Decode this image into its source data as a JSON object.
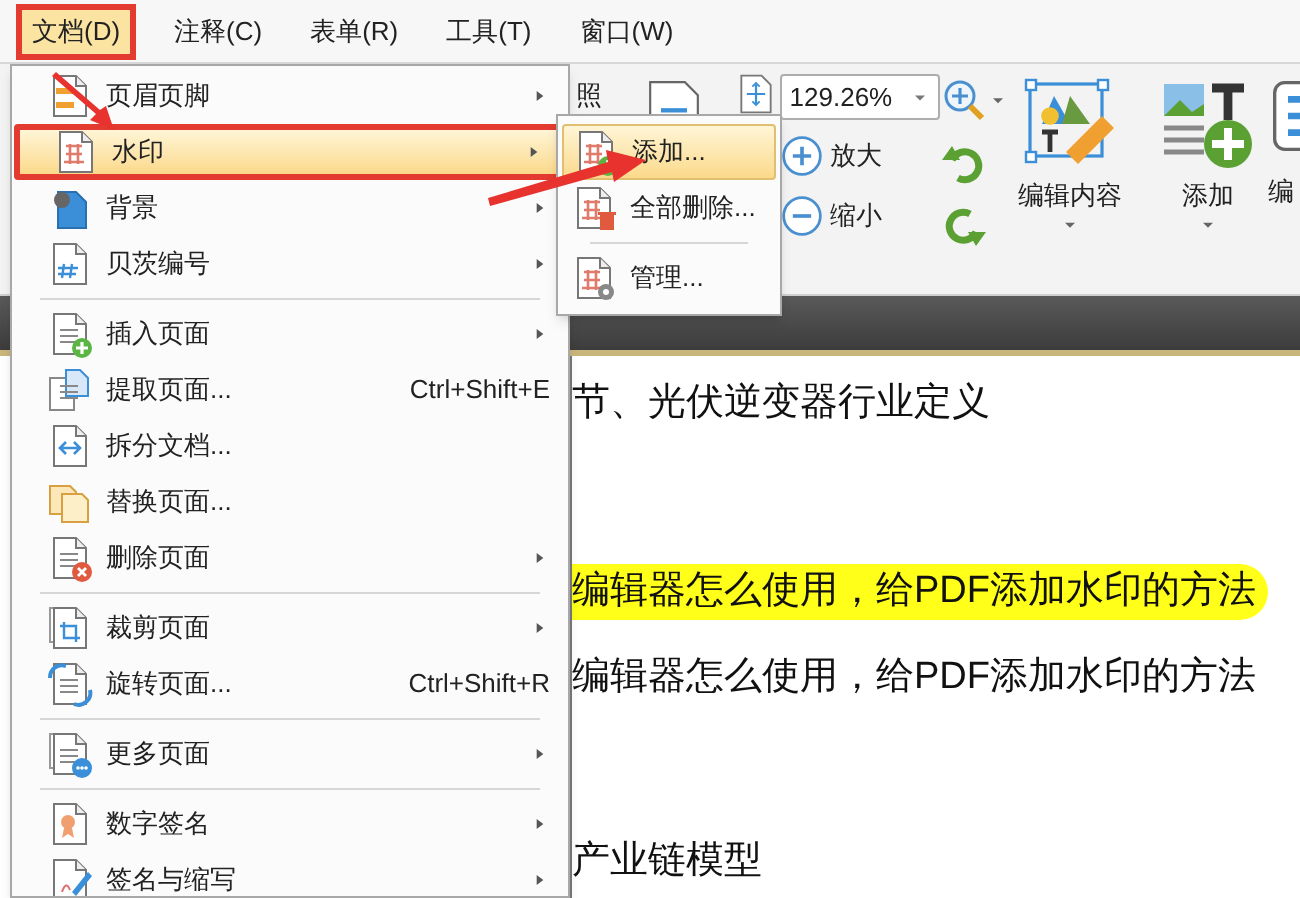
{
  "menubar": [
    {
      "label": "文档(D)",
      "selected": true
    },
    {
      "label": "注释(C)",
      "selected": false
    },
    {
      "label": "表单(R)",
      "selected": false
    },
    {
      "label": "工具(T)",
      "selected": false
    },
    {
      "label": "窗口(W)",
      "selected": false
    }
  ],
  "ribbon": {
    "partial_label": "照",
    "zoom_field": "129.26%",
    "zoom_in": "放大",
    "zoom_out": "缩小",
    "edit_content": "编辑内容",
    "add": "添加",
    "partial_button": "编"
  },
  "document_lines": [
    {
      "text": "节、光伏逆变器行业定义",
      "highlighted": false
    },
    {
      "text": "编辑器怎么使用，给PDF添加水印的方法",
      "highlighted": true
    },
    {
      "text": "编辑器怎么使用，给PDF添加水印的方法",
      "highlighted": false
    },
    {
      "text": "产业链模型",
      "highlighted": false
    }
  ],
  "document_menu": [
    {
      "kind": "item",
      "label": "页眉页脚",
      "submenu": true,
      "selected": false
    },
    {
      "kind": "item",
      "label": "水印",
      "submenu": true,
      "selected": true
    },
    {
      "kind": "item",
      "label": "背景",
      "submenu": true,
      "selected": false
    },
    {
      "kind": "item",
      "label": "贝茨编号",
      "submenu": true,
      "selected": false
    },
    {
      "kind": "separator"
    },
    {
      "kind": "item",
      "label": "插入页面",
      "submenu": true,
      "selected": false
    },
    {
      "kind": "item",
      "label": "提取页面...",
      "shortcut": "Ctrl+Shift+E",
      "submenu": false,
      "selected": false
    },
    {
      "kind": "item",
      "label": "拆分文档...",
      "submenu": false,
      "selected": false
    },
    {
      "kind": "item",
      "label": "替换页面...",
      "submenu": false,
      "selected": false
    },
    {
      "kind": "item",
      "label": "删除页面",
      "submenu": true,
      "selected": false
    },
    {
      "kind": "separator"
    },
    {
      "kind": "item",
      "label": "裁剪页面",
      "submenu": true,
      "selected": false
    },
    {
      "kind": "item",
      "label": "旋转页面...",
      "shortcut": "Ctrl+Shift+R",
      "submenu": false,
      "selected": false
    },
    {
      "kind": "separator"
    },
    {
      "kind": "item",
      "label": "更多页面",
      "submenu": true,
      "selected": false
    },
    {
      "kind": "separator"
    },
    {
      "kind": "item",
      "label": "数字签名",
      "submenu": true,
      "selected": false
    },
    {
      "kind": "item",
      "label": "签名与缩写",
      "submenu": true,
      "selected": false
    }
  ],
  "watermark_submenu": [
    {
      "kind": "item",
      "label": "添加...",
      "selected": true
    },
    {
      "kind": "item",
      "label": "全部删除...",
      "selected": false
    },
    {
      "kind": "separator"
    },
    {
      "kind": "item",
      "label": "管理...",
      "selected": false
    }
  ]
}
